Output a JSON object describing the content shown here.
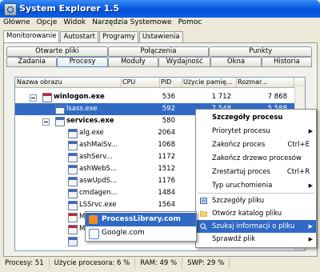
{
  "window": {
    "title": "System Explorer 1.5"
  },
  "menubar": [
    "Główne",
    "Opcje",
    "Widok",
    "Narzędzia Systemowe",
    "Pomoc"
  ],
  "top_tabs": [
    "Monitorowanie",
    "Autostart",
    "Programy",
    "Ustawienia"
  ],
  "tab_row1": [
    "Otwarte pliki",
    "Połączenia",
    "Punkty"
  ],
  "tab_row2": [
    "Zadania",
    "Procesy",
    "Moduły",
    "Wydajność",
    "Okna",
    "Historia"
  ],
  "columns": [
    "Nazwa obrazu",
    "CPU",
    "PID",
    "Użycie pamię...",
    "Rozmar..."
  ],
  "rows": [
    {
      "name": "winlogon.exe",
      "cpu": "",
      "pid": "536",
      "mem": "1 712",
      "size": "7 868"
    },
    {
      "name": "lsass.exe",
      "cpu": "",
      "pid": "592",
      "mem": "7 548",
      "size": "5 588"
    },
    {
      "name": "services.exe",
      "cpu": "",
      "pid": "580",
      "mem": "",
      "size": ""
    },
    {
      "name": "alg.exe",
      "cpu": "",
      "pid": "2064",
      "mem": "",
      "size": ""
    },
    {
      "name": "ashMaiSv...",
      "cpu": "",
      "pid": "1068",
      "mem": "",
      "size": ""
    },
    {
      "name": "ashServ...",
      "cpu": "",
      "pid": "1172",
      "mem": "",
      "size": ""
    },
    {
      "name": "ashWebS...",
      "cpu": "",
      "pid": "1512",
      "mem": "",
      "size": ""
    },
    {
      "name": "aswUpdS...",
      "cpu": "",
      "pid": "1176",
      "mem": "",
      "size": ""
    },
    {
      "name": "cmdagen...",
      "cpu": "",
      "pid": "1484",
      "mem": "",
      "size": ""
    },
    {
      "name": "LSSrvc.exe",
      "cpu": "",
      "pid": "1564",
      "mem": "",
      "size": ""
    },
    {
      "name": "M",
      "cpu": "",
      "pid": "",
      "mem": "",
      "size": ""
    },
    {
      "name": "M",
      "cpu": "",
      "pid": "",
      "mem": "",
      "size": ""
    },
    {
      "name": "",
      "cpu": "",
      "pid": "",
      "mem": "",
      "size": ""
    }
  ],
  "context_menu": {
    "items": [
      {
        "label": "Szczegóły procesu",
        "shortcut": ""
      },
      {
        "label": "Priorytet procesu",
        "shortcut": ""
      },
      {
        "label": "Zakończ proces",
        "shortcut": "Ctrl+E"
      },
      {
        "label": "Zakończ drzewo procesów",
        "shortcut": ""
      },
      {
        "label": "Zrestartuj proces",
        "shortcut": "Ctrl+R"
      },
      {
        "label": "Typ uruchomienia",
        "shortcut": ""
      },
      {
        "label": "Szczegóły pliku",
        "shortcut": ""
      },
      {
        "label": "Otwórz katalog pliku",
        "shortcut": ""
      },
      {
        "label": "Szukaj informacji o pliku",
        "shortcut": ""
      },
      {
        "label": "Sprawdź plik",
        "shortcut": ""
      }
    ]
  },
  "submenu": [
    "ProcessLibrary.com",
    "Google.com"
  ],
  "status": {
    "procesy": "Procesy: 51",
    "cpu": "Użycie procesora: 6 %",
    "ram": "RAM: 49 %",
    "swp": "SWP: 29 %"
  },
  "colors": {
    "selection": "#316ac5",
    "titlebar": "#0a5fe3"
  }
}
